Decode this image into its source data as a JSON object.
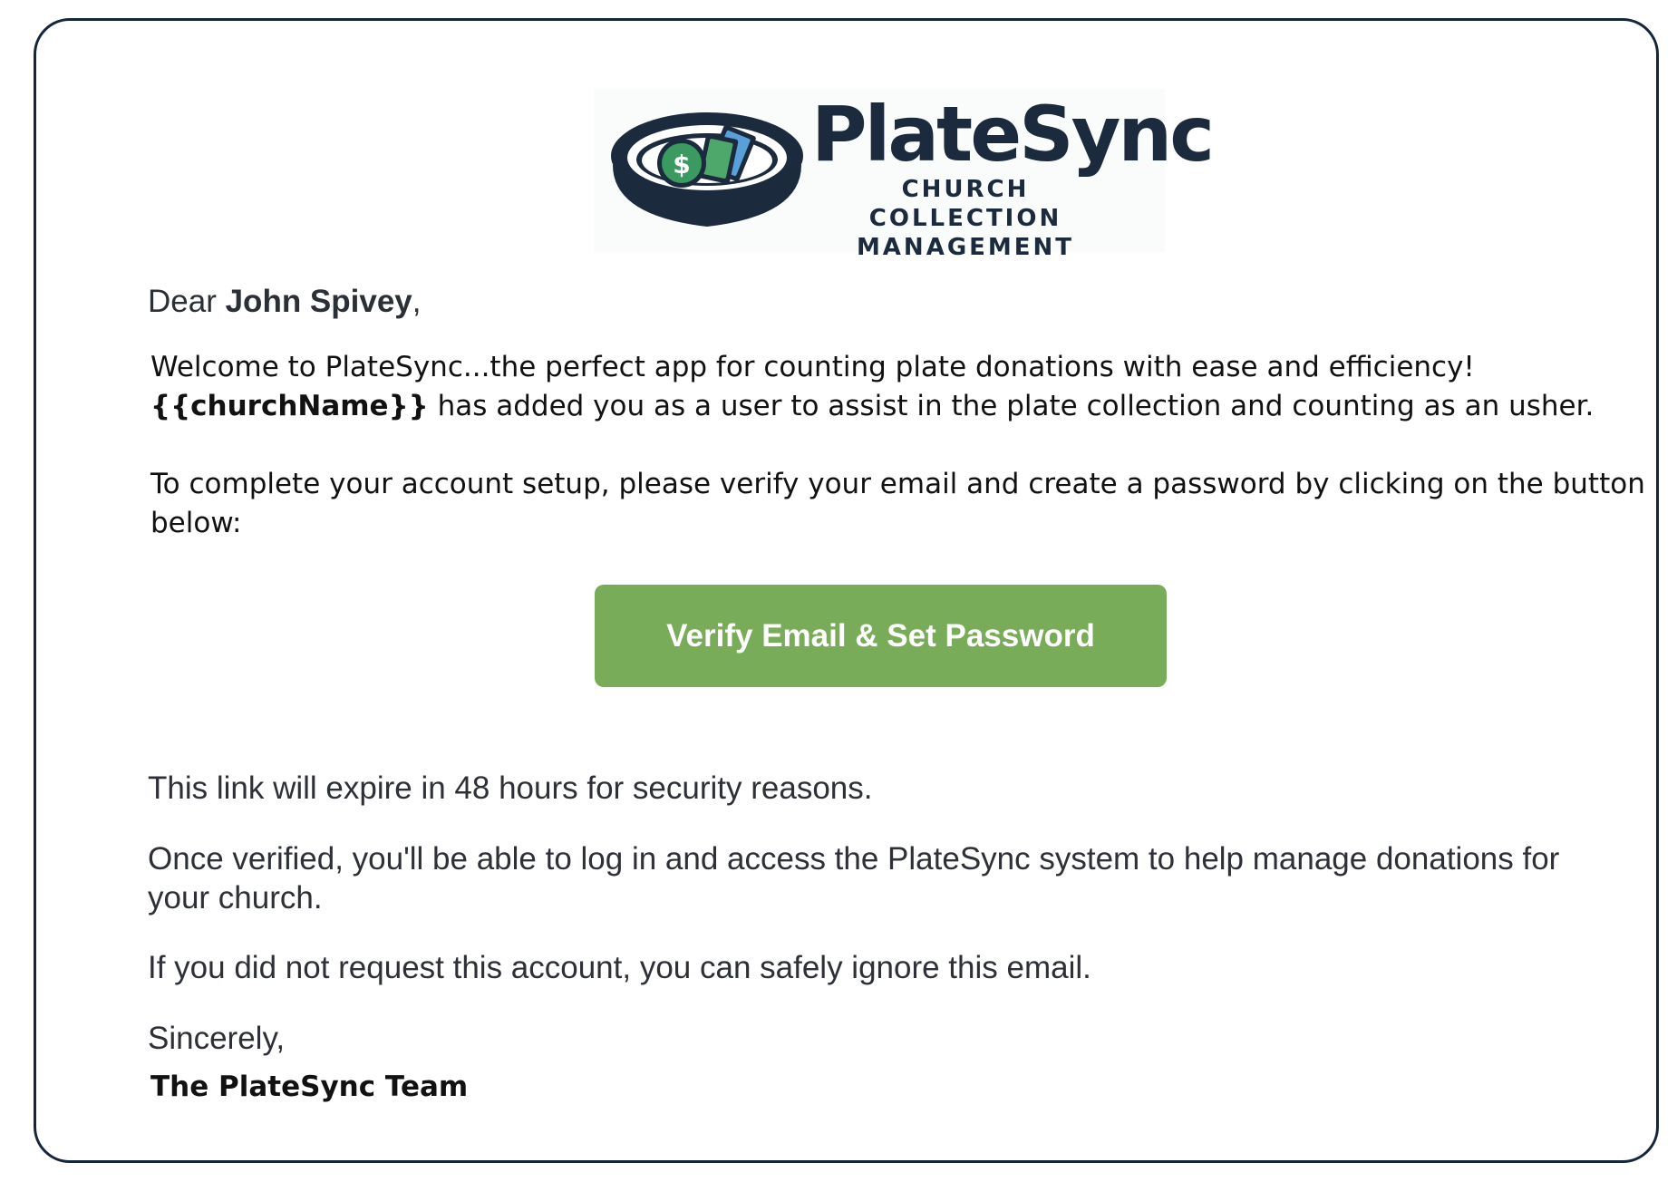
{
  "logo": {
    "name": "PlateSync",
    "tagline_line1": "CHURCH COLLECTION",
    "tagline_line2": "MANAGEMENT",
    "icon": "collection-plate-icon"
  },
  "greeting": {
    "prefix": "Dear ",
    "name": "John Spivey",
    "suffix": ","
  },
  "intro": {
    "line1": "Welcome to PlateSync...the perfect app for counting plate donations with ease and efficiency!",
    "church_placeholder": "{{churchName}}",
    "line2_rest": " has added you as a user to assist in the plate collection and counting as an usher."
  },
  "setup": {
    "line1": "To complete your account setup, please verify your email and create a password by clicking on the button",
    "line2": "below:"
  },
  "button": {
    "label": "Verify Email & Set Password",
    "color": "#79ac58"
  },
  "expiry_note": "This link will expire in 48 hours for security reasons.",
  "verified_note": {
    "line1": "Once verified, you'll be able to log in and access the PlateSync system to help manage donations for",
    "line2": "your church."
  },
  "ignore_note": "If you did not request this account, you can safely ignore this email.",
  "closing": "Sincerely,",
  "signature": "The PlateSync Team",
  "colors": {
    "border": "#15263a",
    "brand_dark": "#1b2a3c",
    "brand_green": "#3a9a60"
  }
}
